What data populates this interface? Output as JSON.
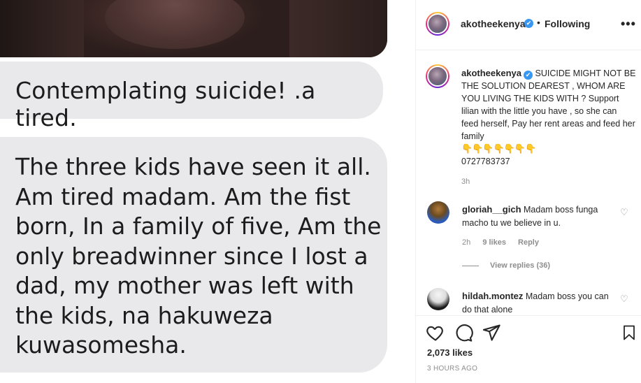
{
  "post_image": {
    "bubble_1": "Contemplating suicide! .a tired.",
    "bubble_2_lines": [
      "The three kids have seen it all.",
      "Am tired madam. Am the fist",
      "born, In a family of five, Am the",
      "only breadwinner since I  lost a",
      "dad, my mother was left with",
      "the kids, na hakuweza",
      "kuwasomesha."
    ]
  },
  "header": {
    "username": "akotheekenya",
    "verified_mark": "✔",
    "separator": "•",
    "follow_status": "Following",
    "more_glyph": "•••"
  },
  "caption": {
    "username": "akotheekenya",
    "verified_mark": "✔",
    "text": "SUICIDE MIGHT NOT BE THE SOLUTION DEAREST , WHOM ARE YOU LIVING THE KIDS WITH ? Support lilian with the little you have , so she can feed herself, Pay her rent areas and feed her family",
    "emojis": "👇👇👇👇👇👇👇",
    "phone": "0727783737",
    "time": "3h"
  },
  "comments": [
    {
      "username": "gloriah__gich",
      "text": "Madam boss funga macho tu we believe in u.",
      "time": "2h",
      "likes": "9 likes",
      "reply_label": "Reply",
      "view_replies": "View replies (36)"
    },
    {
      "username": "hildah.montez",
      "text": "Madam boss you can do that alone"
    }
  ],
  "footer": {
    "likes": "2,073 likes",
    "time": "3 HOURS AGO"
  },
  "colors": {
    "verified_blue": "#3897f0",
    "secondary_text": "#8e8e8e",
    "bubble_gray": "#e9e9eb"
  }
}
